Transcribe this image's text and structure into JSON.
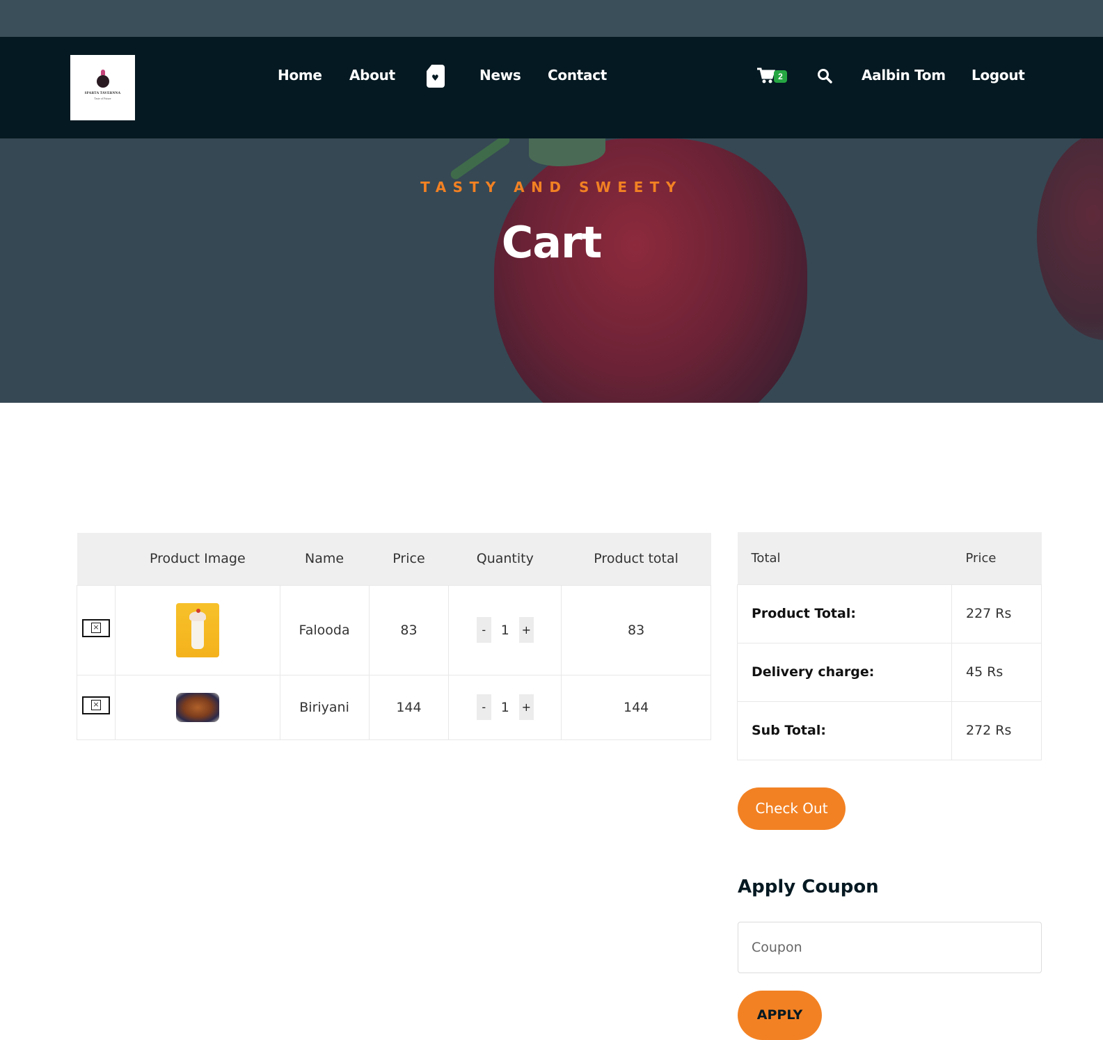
{
  "brand": {
    "logo_name": "SPARTA TAVERNNA",
    "logo_tagline": "Taste of Future"
  },
  "nav": {
    "home": "Home",
    "about": "About",
    "shop_icon": "shop-bag-heart-icon",
    "news": "News",
    "contact": "Contact",
    "cart_count": "2",
    "user": "Aalbin Tom",
    "logout": "Logout"
  },
  "hero": {
    "subtitle": "TASTY AND SWEETY",
    "title": "Cart"
  },
  "cart": {
    "headers": [
      "",
      "Product Image",
      "Name",
      "Price",
      "Quantity",
      "Product total"
    ],
    "rows": [
      {
        "name": "Falooda",
        "price": "83",
        "qty": "1",
        "total": "83",
        "minus": "-",
        "plus": "+"
      },
      {
        "name": "Biriyani",
        "price": "144",
        "qty": "1",
        "total": "144",
        "minus": "-",
        "plus": "+"
      }
    ]
  },
  "totals": {
    "header_total": "Total",
    "header_price": "Price",
    "rows": [
      {
        "label": "Product Total:",
        "value": "227 Rs"
      },
      {
        "label": "Delivery charge:",
        "value": "45 Rs"
      },
      {
        "label": "Sub Total:",
        "value": "272 Rs"
      }
    ]
  },
  "checkout": {
    "label": "Check Out"
  },
  "coupon": {
    "title": "Apply Coupon",
    "placeholder": "Coupon",
    "apply_label": "APPLY"
  },
  "colors": {
    "accent": "#f28123",
    "nav_bg": "#051922",
    "badge": "#26a643"
  }
}
